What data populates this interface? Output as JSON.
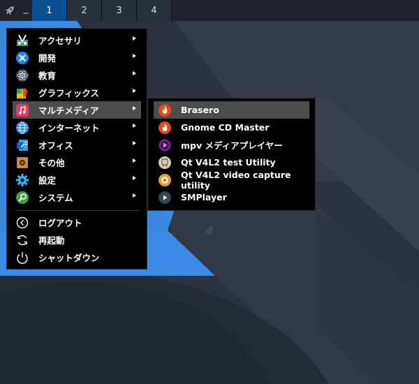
{
  "colors": {
    "wallpaper_dark": "#2b323d",
    "wallpaper_mid": "#353c47",
    "wallpaper_blue": "#3b8ae6",
    "panel": "#1f242c",
    "workspace_active": "#0d4f95",
    "menu_bg": "#000000",
    "menu_highlight": "#4d4d4d"
  },
  "panel": {
    "launcher_icon": "rocket-icon",
    "separator": "_",
    "workspaces": [
      "1",
      "2",
      "3",
      "4"
    ],
    "active_workspace": "1"
  },
  "main_menu": {
    "categories": [
      {
        "label": "アクセサリ",
        "icon": "accessories-icon",
        "has_submenu": true
      },
      {
        "label": "開発",
        "icon": "development-icon",
        "has_submenu": true
      },
      {
        "label": "教育",
        "icon": "education-icon",
        "has_submenu": true
      },
      {
        "label": "グラフィックス",
        "icon": "graphics-icon",
        "has_submenu": true
      },
      {
        "label": "マルチメディア",
        "icon": "multimedia-icon",
        "has_submenu": true,
        "highlighted": true
      },
      {
        "label": "インターネット",
        "icon": "internet-icon",
        "has_submenu": true
      },
      {
        "label": "オフィス",
        "icon": "office-icon",
        "has_submenu": true
      },
      {
        "label": "その他",
        "icon": "other-icon",
        "has_submenu": true
      },
      {
        "label": "設定",
        "icon": "settings-icon",
        "has_submenu": true
      },
      {
        "label": "システム",
        "icon": "system-icon",
        "has_submenu": true
      }
    ],
    "actions": [
      {
        "label": "ログアウト",
        "icon": "logout-icon"
      },
      {
        "label": "再起動",
        "icon": "reboot-icon"
      },
      {
        "label": "シャットダウン",
        "icon": "shutdown-icon"
      }
    ]
  },
  "submenu": {
    "items": [
      {
        "label": "Brasero",
        "icon": "brasero-icon",
        "highlighted": true
      },
      {
        "label": "Gnome CD Master",
        "icon": "gnome-cd-master-icon"
      },
      {
        "label": "mpv メディアプレイヤー",
        "icon": "mpv-icon"
      },
      {
        "label": "Qt V4L2 test Utility",
        "icon": "qv4l2-icon"
      },
      {
        "label": "Qt V4L2 video capture utility",
        "icon": "qvidcap-icon"
      },
      {
        "label": "SMPlayer",
        "icon": "smplayer-icon"
      }
    ]
  }
}
